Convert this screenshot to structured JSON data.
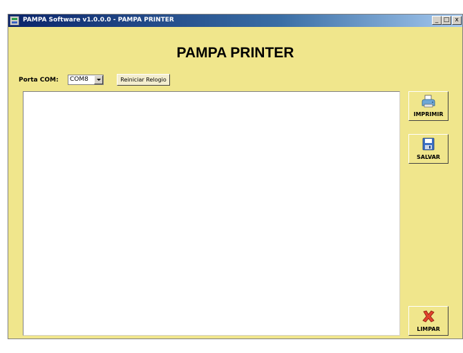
{
  "window": {
    "title": "PAMPA Software v1.0.0.0 - PAMPA PRINTER"
  },
  "caption_buttons": {
    "minimize": "_",
    "maximize": "□",
    "close": "x"
  },
  "app": {
    "heading": "PAMPA PRINTER"
  },
  "toolbar": {
    "porta_label": "Porta COM:",
    "porta_value": "COM8",
    "reiniciar_label": "Reiniciar Relogio"
  },
  "text_area": {
    "value": ""
  },
  "side_buttons": {
    "imprimir": {
      "label": "IMPRIMIR",
      "icon": "printer-icon"
    },
    "salvar": {
      "label": "SALVAR",
      "icon": "save-icon"
    },
    "limpar": {
      "label": "LIMPAR",
      "icon": "clear-icon"
    }
  },
  "colors": {
    "background": "#f0e68c",
    "titlebar": "#0a246a"
  }
}
